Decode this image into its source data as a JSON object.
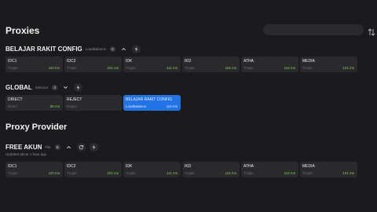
{
  "header": {
    "title": "Proxies",
    "search_placeholder": "",
    "sort_icon": "sort-arrows-icon"
  },
  "groups": [
    {
      "name": "BELAJAR RAKIT CONFIG",
      "type": "LoadBalance",
      "count": "6",
      "proxies": [
        {
          "name": "IDC1",
          "type": "Trojan",
          "delay": "110 ms"
        },
        {
          "name": "IDC2",
          "type": "Trojan",
          "delay": "101 ms"
        },
        {
          "name": "IDK",
          "type": "Trojan",
          "delay": "111 ms"
        },
        {
          "name": "IKD",
          "type": "Trojan",
          "delay": "115 ms"
        },
        {
          "name": "ATHA",
          "type": "Trojan",
          "delay": "114 ms"
        },
        {
          "name": "MEDIA",
          "type": "Trojan",
          "delay": "121 ms"
        }
      ]
    },
    {
      "name": "GLOBAL",
      "type": "Selector",
      "count": "3",
      "proxies": [
        {
          "name": "DIRECT",
          "type": "Direct",
          "delay": "85 ms"
        },
        {
          "name": "REJECT",
          "type": "Reject",
          "delay": ""
        },
        {
          "name": "BELAJAR RAKIT CONFIG",
          "type": "LoadBalance",
          "delay": "115 ms",
          "selected": true
        }
      ]
    }
  ],
  "provider_section": {
    "title": "Proxy Provider",
    "provider": {
      "name": "FREE AKUN",
      "type": "File",
      "count": "6",
      "updated": "Updated about 1 hour ago",
      "proxies": [
        {
          "name": "IDC1",
          "type": "Trojan",
          "delay": "110 ms"
        },
        {
          "name": "IDC2",
          "type": "Trojan",
          "delay": "101 ms"
        },
        {
          "name": "IDK",
          "type": "Trojan",
          "delay": "111 ms"
        },
        {
          "name": "IKD",
          "type": "Trojan",
          "delay": "115 ms"
        },
        {
          "name": "ATHA",
          "type": "Trojan",
          "delay": "114 ms"
        },
        {
          "name": "MEDIA",
          "type": "Trojan",
          "delay": "121 ms"
        }
      ]
    }
  },
  "colors": {
    "accent": "#2273e6",
    "delay_good": "#7ed05b",
    "background": "#1b1b1d",
    "card": "#2a2a2d"
  }
}
